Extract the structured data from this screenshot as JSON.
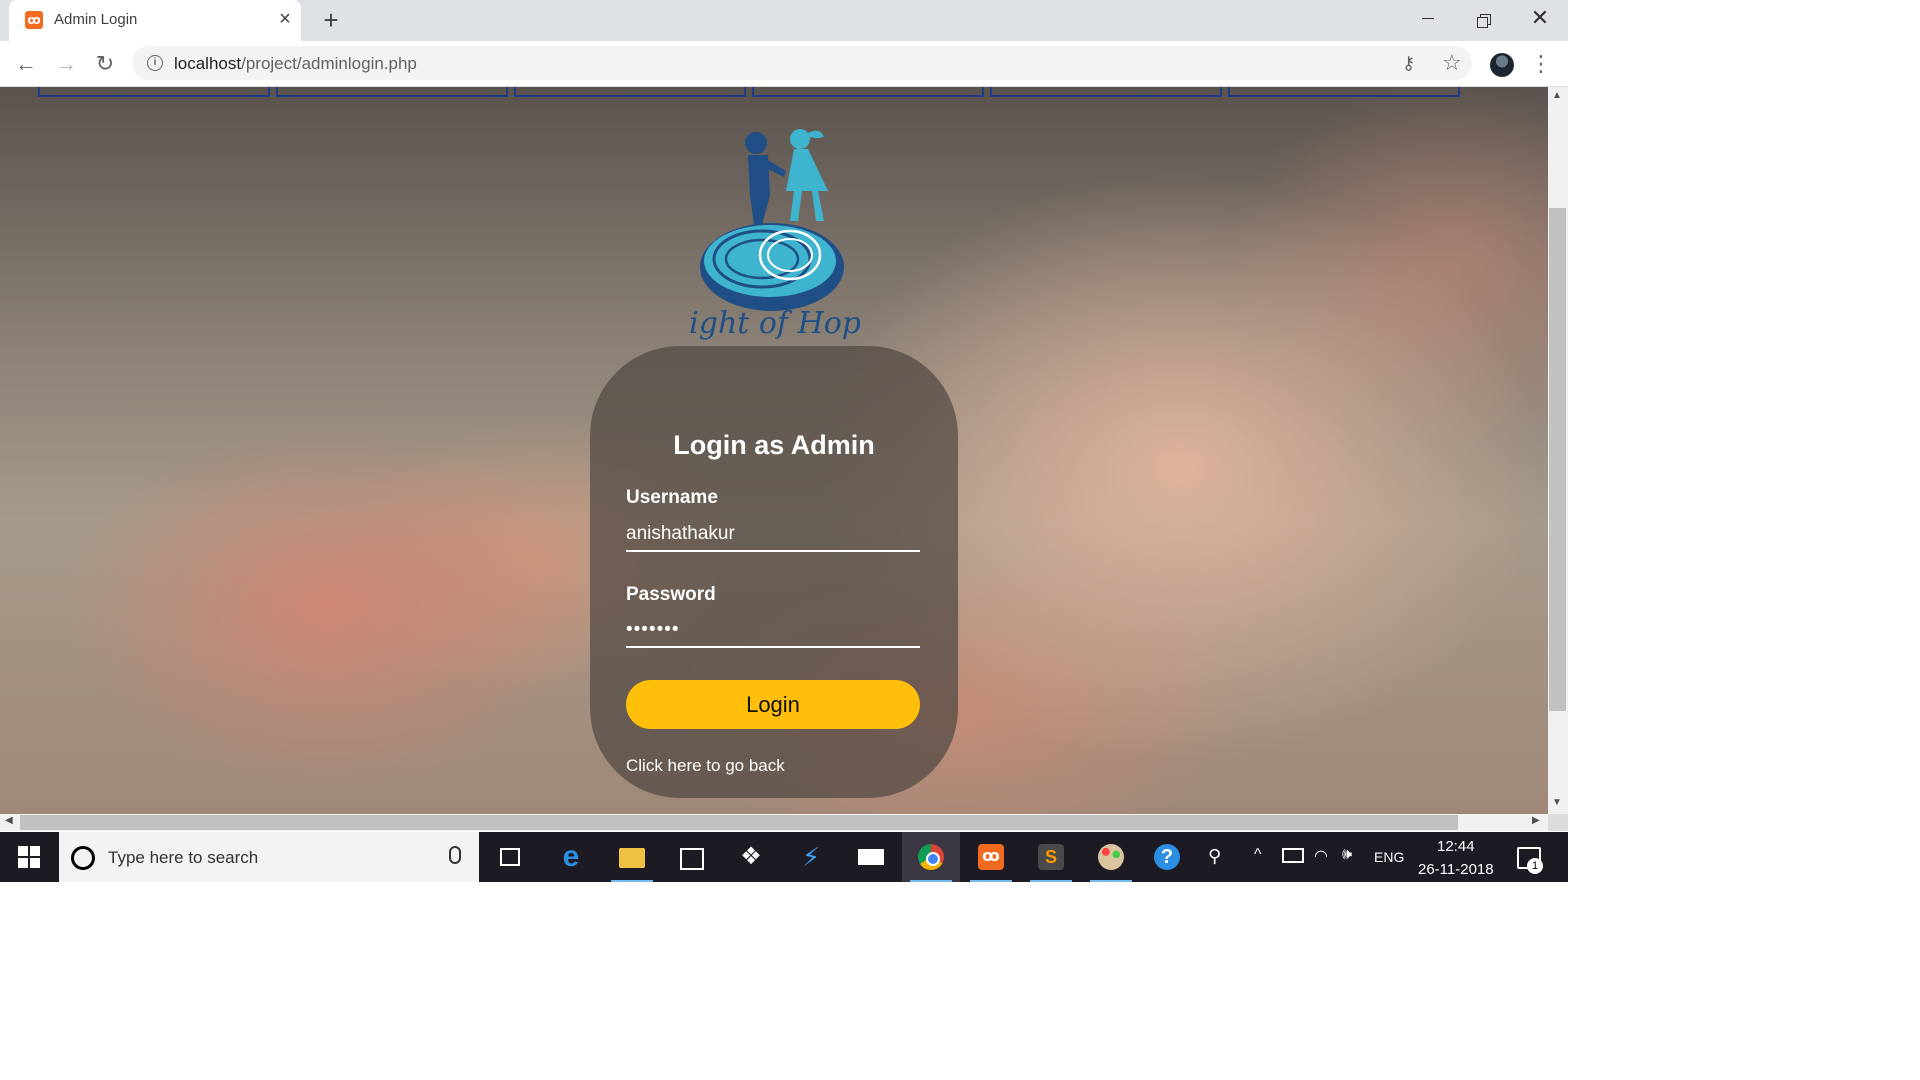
{
  "browser": {
    "tab_title": "Admin Login",
    "tab_close": "×",
    "new_tab": "+",
    "url_host": "localhost",
    "url_path": "/project/adminlogin.php"
  },
  "page": {
    "logo_text": "Light of Hope",
    "nav_box_count": 6
  },
  "login": {
    "title": "Login as Admin",
    "username_label": "Username",
    "username_value": "anishathakur",
    "password_label": "Password",
    "password_value": "•••••••",
    "button_label": "Login",
    "back_link": "Click here to go back"
  },
  "colors": {
    "button": "#ffbf0a",
    "nav_border": "#1e3b8a",
    "logo_blue": "#1f4f86",
    "logo_light": "#3fb4cf"
  },
  "taskbar": {
    "search_placeholder": "Type here to search",
    "icons": [
      "task-view-icon",
      "edge-icon",
      "file-explorer-icon",
      "store-icon",
      "dropbox-icon",
      "visual-studio-icon",
      "mail-icon",
      "chrome-icon",
      "xampp-icon",
      "sublime-text-icon",
      "paint-icon",
      "help-icon"
    ],
    "tray_language": "ENG",
    "time": "12:44",
    "date": "26-11-2018",
    "notifications": "1"
  }
}
